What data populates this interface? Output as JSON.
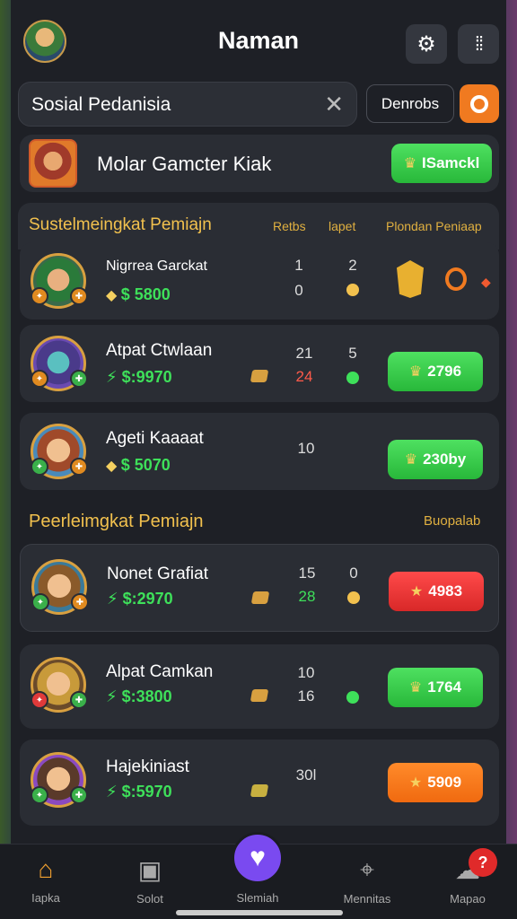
{
  "header": {
    "title": "Naman",
    "settings_icon": "gear-icon",
    "menu_icon": "grid-dots-icon"
  },
  "search": {
    "value": "Sosial Pedanisia",
    "clear_icon": "close-icon"
  },
  "toolbar": {
    "dark_button_label": "Denrobs",
    "orange_button_icon": "ring-icon"
  },
  "banner": {
    "text": "Molar Gamcter Kiak",
    "button_label": "ISamckl"
  },
  "section1": {
    "title": "Sustelmeingkat Pemiajn",
    "col1": "Retbs",
    "col2": "lapet",
    "col3": "Plondan Peniaap"
  },
  "section1_rows": [
    {
      "name": "Nigrrea Garckat",
      "money": "$ 5800",
      "stat1a": "1",
      "stat1b": "0",
      "stat2a": "2",
      "dot_color": "#f2c14e"
    },
    {
      "name": "Atpat Ctwlaan",
      "money": "$:9970",
      "stat1a": "21",
      "stat1b": "24",
      "stat2a": "5",
      "dot_color": "#3ee05a",
      "button": "2796"
    },
    {
      "name": "Ageti Kaaaat",
      "money": "$ 5070",
      "stat1a": "10",
      "button": "230by"
    }
  ],
  "section2": {
    "title": "Peerleimgkat Pemiajn",
    "right_label": "Buopalab"
  },
  "section2_rows": [
    {
      "name": "Nonet Grafiat",
      "money": "$:2970",
      "stat1a": "15",
      "stat1b": "28",
      "stat2a": "0",
      "dot_color": "#f2c14e",
      "button": "4983"
    },
    {
      "name": "Alpat Camkan",
      "money": "$:3800",
      "stat1a": "10",
      "stat1b": "16",
      "dot_color": "#3ee05a",
      "button": "1764"
    },
    {
      "name": "Hajekiniast",
      "money": "$:5970",
      "stat1a": "30l",
      "button": "5909"
    }
  ],
  "bottom_nav": [
    {
      "label": "Iapka",
      "icon": "home-icon"
    },
    {
      "label": "Solot",
      "icon": "tv-icon"
    },
    {
      "label": "Slemiah",
      "icon": "heart-icon"
    },
    {
      "label": "Mennitas",
      "icon": "map-icon"
    },
    {
      "label": "Mapao",
      "icon": "chat-icon",
      "badge": "?"
    }
  ],
  "colors": {
    "accent_green": "#3ee05a",
    "accent_orange": "#f07a20",
    "accent_gold": "#f2c14e",
    "accent_red": "#e02a2a",
    "accent_purple": "#7a4af0"
  }
}
